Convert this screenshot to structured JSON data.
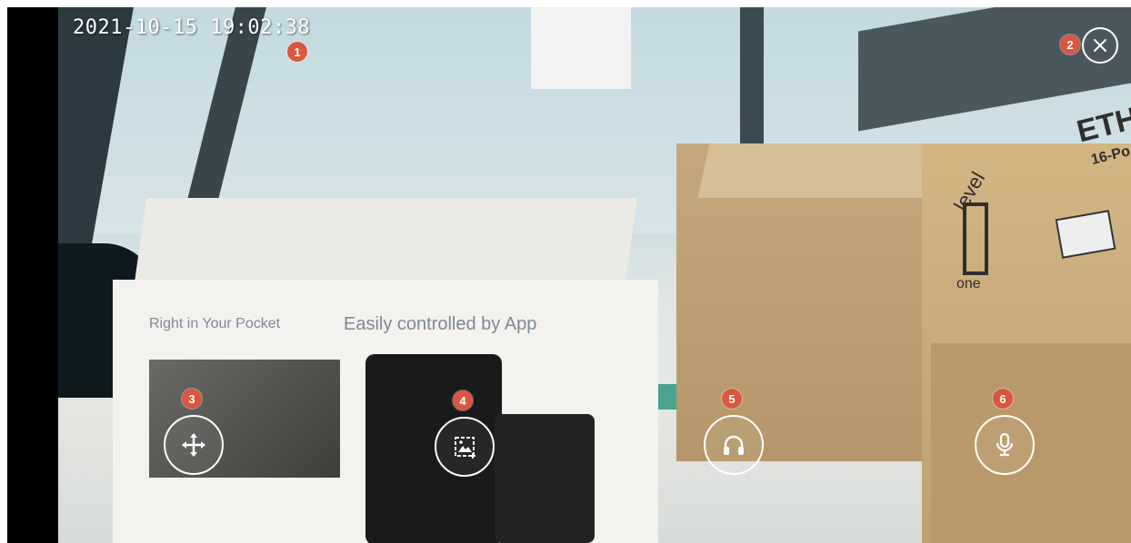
{
  "overlay": {
    "timestamp": "2021-10-15 19:02:38",
    "markers": [
      "1",
      "2",
      "3",
      "4",
      "5",
      "6"
    ]
  },
  "controls": {
    "close_icon": "close-icon",
    "move_icon": "pan-move-icon",
    "snapshot_icon": "snapshot-icon",
    "listen_icon": "headphones-icon",
    "talk_icon": "microphone-icon"
  },
  "scene": {
    "box_left_heading": "Right in Your Pocket",
    "box_left_subheading": "Easily controlled by App",
    "brand_name": "level",
    "brand_sub": "one",
    "box_right_label": "ETHE",
    "box_right_sub": "16-Po"
  },
  "colors": {
    "marker": "#d9573e",
    "control_ring": "#ffffff"
  }
}
